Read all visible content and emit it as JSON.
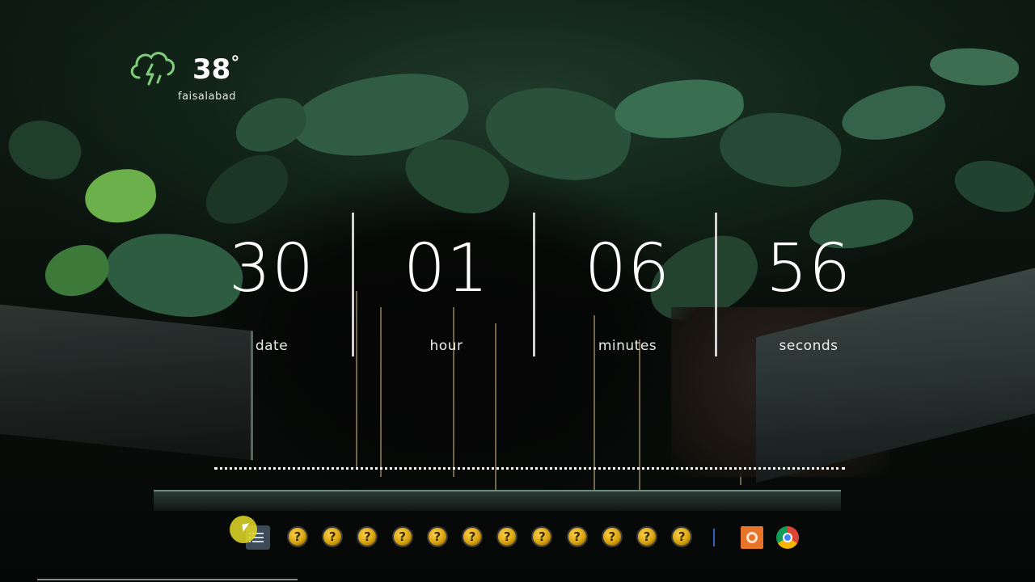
{
  "weather": {
    "temperature": "38",
    "degree_symbol": "°",
    "city": "faisalabad",
    "icon": "cloud-rain-icon"
  },
  "clock": {
    "units": [
      {
        "value": "30",
        "label": "date"
      },
      {
        "value": "01",
        "label": "hour"
      },
      {
        "value": "06",
        "label": "minutes"
      },
      {
        "value": "56",
        "label": "seconds"
      }
    ]
  },
  "dock": {
    "menu_icon": "app-launcher-icon",
    "unknown_app_icon": "question-mark-icon",
    "unknown_app_glyph": "?",
    "unknown_app_count": 12,
    "pinned": [
      {
        "name": "orange-app-icon"
      },
      {
        "name": "chrome-icon"
      }
    ]
  },
  "colors": {
    "accent_orange": "#e8742a",
    "cursor_highlight": "#e6dc28",
    "text": "#ffffff"
  }
}
